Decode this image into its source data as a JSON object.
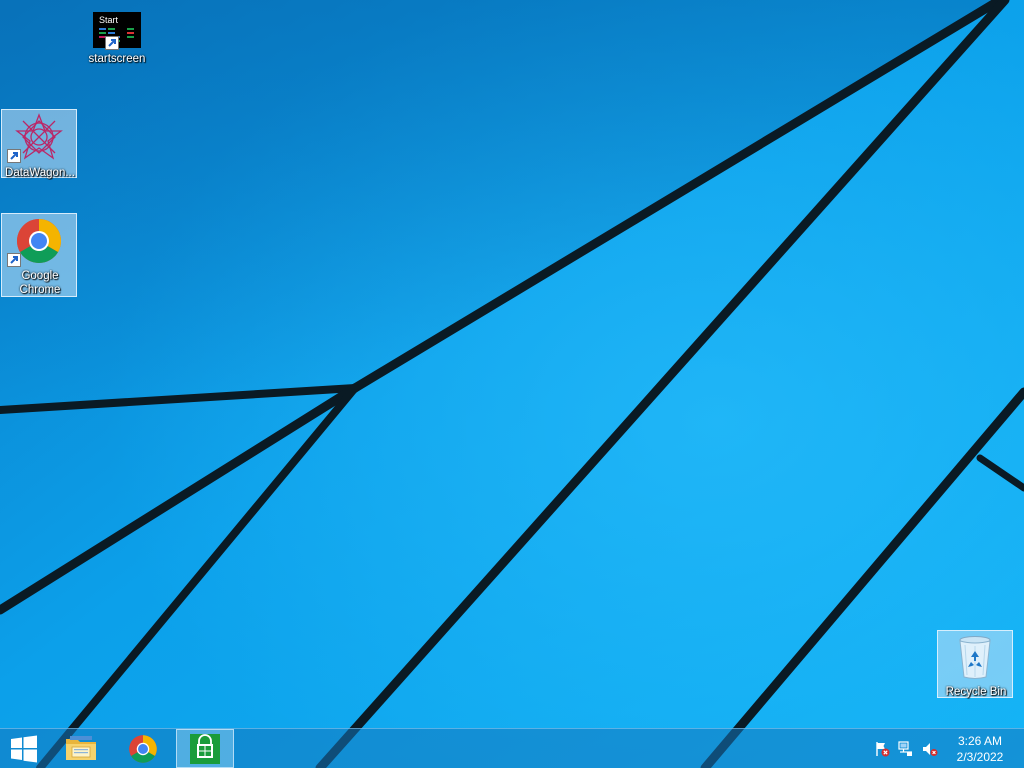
{
  "desktop": {
    "icons": [
      {
        "label": "startscreen",
        "icon": "start-tile-icon",
        "tile_title": "Start"
      },
      {
        "label": "DataWagon...",
        "icon": "datawagon-icon"
      },
      {
        "label": "Google Chrome",
        "icon": "chrome-icon"
      },
      {
        "label": "Recycle Bin",
        "icon": "recycle-bin-icon"
      }
    ]
  },
  "taskbar": {
    "buttons": [
      {
        "icon": "windows-start-icon"
      },
      {
        "icon": "file-explorer-icon"
      },
      {
        "icon": "chrome-icon"
      },
      {
        "icon": "windows-store-icon"
      }
    ],
    "tray": {
      "icons": [
        "action-center-flag-icon",
        "network-icon",
        "volume-muted-icon"
      ],
      "time": "3:26 AM",
      "date": "2/3/2022"
    }
  },
  "colors": {
    "wallpaper_blue": "#0b9ee8",
    "wallpaper_dark": "#0a1a24",
    "chrome_red": "#db4437",
    "chrome_green": "#0f9d58",
    "chrome_yellow": "#f4b400",
    "chrome_blue": "#4285f4",
    "store_green": "#1a9c3a"
  }
}
